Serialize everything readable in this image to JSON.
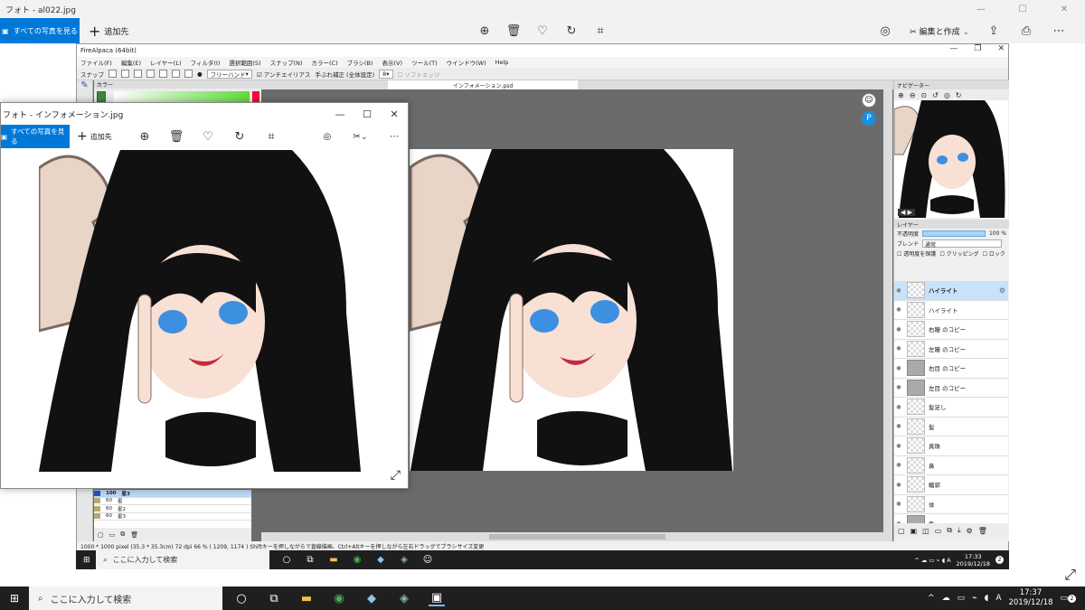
{
  "outer": {
    "title": "フォト - al022.jpg",
    "all_photos": "すべての写真を見る",
    "add": "追加先",
    "edit_create": "編集と作成"
  },
  "firealpaca": {
    "title": "FireAlpaca (64bit)",
    "menu": [
      "ファイル(F)",
      "編集(E)",
      "レイヤー(L)",
      "フィルタ(I)",
      "選択範囲(S)",
      "スナップ(N)",
      "カラー(C)",
      "ブラシ(B)",
      "表示(V)",
      "ツール(T)",
      "ウインドウ(W)",
      "Help"
    ],
    "toolbar": {
      "snap": "スナップ",
      "freehand": "フリーハンド",
      "antialias": "アンチエイリアス",
      "stabilizer": "手ぶれ補正 (全体設定)",
      "stabilizer_value": "8",
      "soft_edge": "ソフトエッジ"
    },
    "color_panel": "カラー",
    "tab": "インフォメーション.psd",
    "navigator": "ナビゲーター",
    "layer_panel": "レイヤー",
    "opacity_label": "不透明度",
    "opacity_value": "100 %",
    "blend_label": "ブレンド",
    "blend_value": "通常",
    "protect_alpha": "透明度を保護",
    "clipping": "クリッピング",
    "lock": "ロック",
    "layers": [
      {
        "name": "ハイライト",
        "type": "layer",
        "selected": true
      },
      {
        "name": "ハイライト",
        "type": "layer"
      },
      {
        "name": "右瞳 のコピー",
        "type": "layer"
      },
      {
        "name": "左瞳 のコピー",
        "type": "layer"
      },
      {
        "name": "右目 のコピー",
        "type": "folder"
      },
      {
        "name": "左目 のコピー",
        "type": "folder"
      },
      {
        "name": "髪足し",
        "type": "layer"
      },
      {
        "name": "髪",
        "type": "layer"
      },
      {
        "name": "真珠",
        "type": "layer"
      },
      {
        "name": "鼻",
        "type": "layer"
      },
      {
        "name": "輪郭",
        "type": "layer"
      },
      {
        "name": "体",
        "type": "layer"
      },
      {
        "name": "色",
        "type": "folder"
      }
    ],
    "left_layers": [
      {
        "opacity": "100",
        "name": "星3",
        "color": "#2a4fc4",
        "selected": true
      },
      {
        "opacity": "60",
        "name": "星",
        "color": "#b8a870"
      },
      {
        "opacity": "60",
        "name": "星2",
        "color": "#b8a870"
      },
      {
        "opacity": "60",
        "name": "星3",
        "color": "#b8a870"
      }
    ],
    "status": "1000 * 1000 pixel  (35.3 * 35.3cm)  72 dpi  66 %  ( 1209, 1174 )  Shiftキーを押しながらで直線描画、Ctrl+Altキーを押しながら左右ドラッグでブラシサイズ変更"
  },
  "photo_window": {
    "title": "フォト - インフォメーション.jpg",
    "all_photos": "すべての写真を見る",
    "add": "追加先"
  },
  "inner_taskbar": {
    "search": "ここに入力して検索",
    "time": "17:33",
    "date": "2019/12/18",
    "badge": "2"
  },
  "taskbar": {
    "search": "ここに入力して検索",
    "ime": "A",
    "time": "17:37",
    "date": "2019/12/18",
    "badge": "2"
  },
  "colors": {
    "accent": "#0078d7",
    "taskbar": "#1f1f1f",
    "canvas_bg": "#6b6b6b",
    "layer_selected": "#c8e2fb"
  }
}
